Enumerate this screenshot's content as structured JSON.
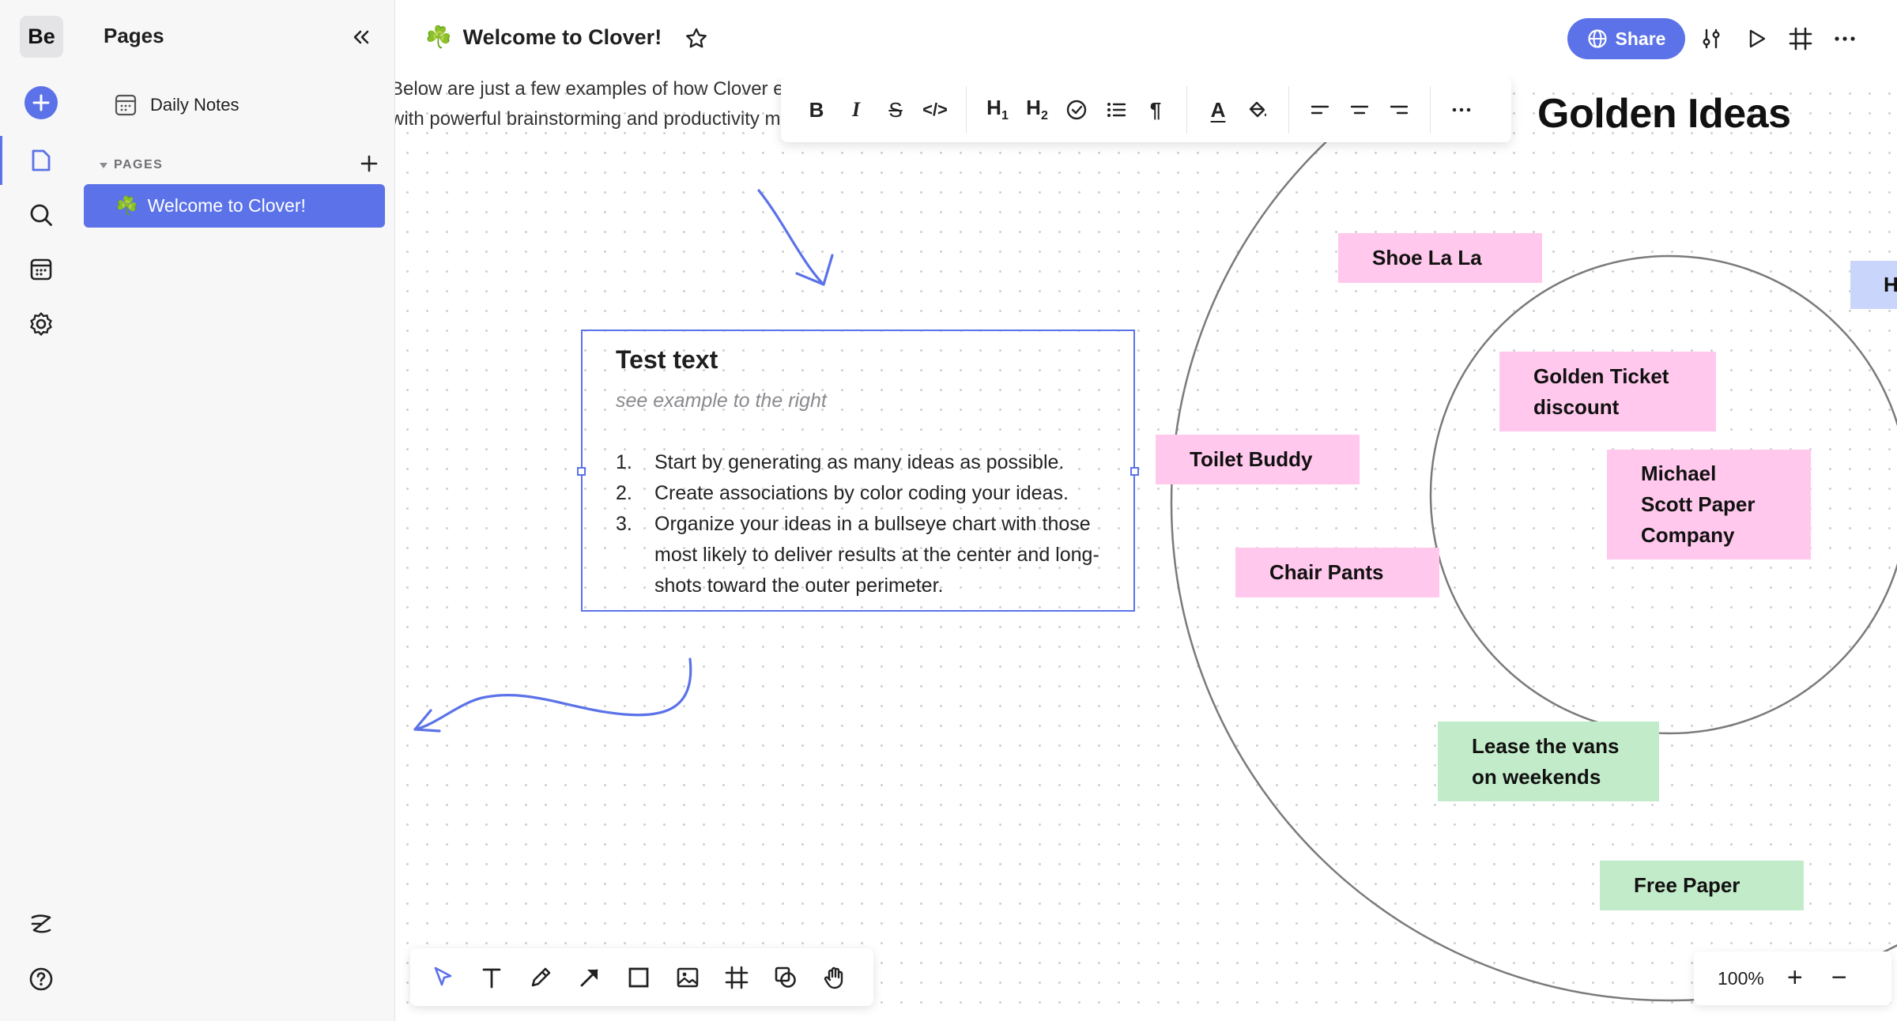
{
  "workspace": {
    "logo": "Be"
  },
  "rail": {
    "icons": [
      "plus-icon",
      "pages-icon",
      "search-icon",
      "calendar-icon",
      "settings-icon",
      "brand-icon",
      "help-icon"
    ]
  },
  "panel": {
    "title": "Pages",
    "daily_notes": "Daily Notes",
    "section_label": "PAGES",
    "pages": [
      {
        "emoji": "☘️",
        "label": "Welcome to Clover!",
        "selected": true
      }
    ]
  },
  "header": {
    "emoji": "☘️",
    "title": "Welcome to Clover!",
    "share_label": "Share"
  },
  "canvas": {
    "intro_line1": "Below are just a few examples of how Clover enables you to",
    "intro_line2": "with powerful brainstorming and productivity methods.",
    "format_toolbar": [
      "B",
      "I",
      "S",
      "</>",
      "H1",
      "H2",
      "check",
      "list",
      "¶",
      "A",
      "fill",
      "align-left",
      "align-center",
      "align-right",
      "more"
    ],
    "heading": "Golden Ideas",
    "textbox": {
      "title": "Test text",
      "subtitle": "see example to the right",
      "items": [
        {
          "num": "1.",
          "text": "Start by generating as many ideas as possible."
        },
        {
          "num": "2.",
          "text": "Create associations by color coding your ideas."
        },
        {
          "num": "3.",
          "text": "Organize your ideas in a bullseye chart with those most likely to deliver results at the center and long-shots toward the outer perimeter."
        }
      ]
    },
    "stickies": {
      "shoe": "Shoe La La",
      "toilet": "Toilet Buddy",
      "chair": "Chair Pants",
      "golden_ticket_1": "Golden Ticket",
      "golden_ticket_2": "discount",
      "michael_1": "Michael",
      "michael_2": "Scott Paper",
      "michael_3": "Company",
      "lease_1": "Lease the vans",
      "lease_2": "on weekends",
      "free_paper": "Free Paper",
      "partial": "H"
    },
    "colors": {
      "accent": "#5b72e8",
      "pink": "#ffc8ec",
      "green": "#c2ebc9",
      "blue": "#c9d5fb"
    }
  },
  "bottom_toolbar": {
    "tools": [
      "select-icon",
      "text-icon",
      "pen-icon",
      "arrow-icon",
      "rectangle-icon",
      "image-icon",
      "frame-icon",
      "shapes-icon",
      "hand-icon"
    ]
  },
  "zoom": {
    "level": "100%",
    "plus": "+",
    "minus": "−"
  }
}
